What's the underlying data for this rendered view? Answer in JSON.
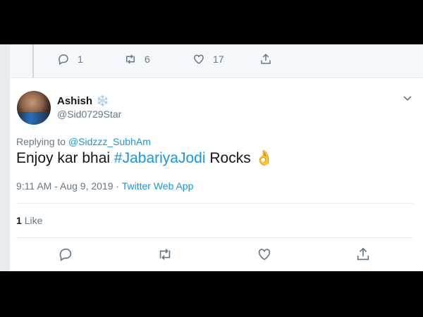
{
  "top_tweet": {
    "actions": {
      "reply_count": "1",
      "retweet_count": "6",
      "like_count": "17"
    }
  },
  "tweet": {
    "author_name": "Ashish",
    "name_emoji": "❄️",
    "handle": "@Sid0729Star",
    "replying_prefix": "Replying to",
    "replying_to": "@Sidzzz_SubhAm",
    "text_before": "Enjoy kar bhai ",
    "hashtag": "#JabariyaJodi",
    "text_after": " Rocks ",
    "emoji": "👌",
    "time": "9:11 AM - Aug 9, 2019 · ",
    "source": "Twitter Web App",
    "likes_count": "1",
    "likes_label": "Like"
  },
  "icons": [
    "reply-icon",
    "retweet-icon",
    "like-icon",
    "share-icon",
    "chevron-down-icon"
  ],
  "colors": {
    "link": "#1b95e0",
    "muted": "#657786",
    "text": "#14171a",
    "letterbox": "#000000"
  }
}
